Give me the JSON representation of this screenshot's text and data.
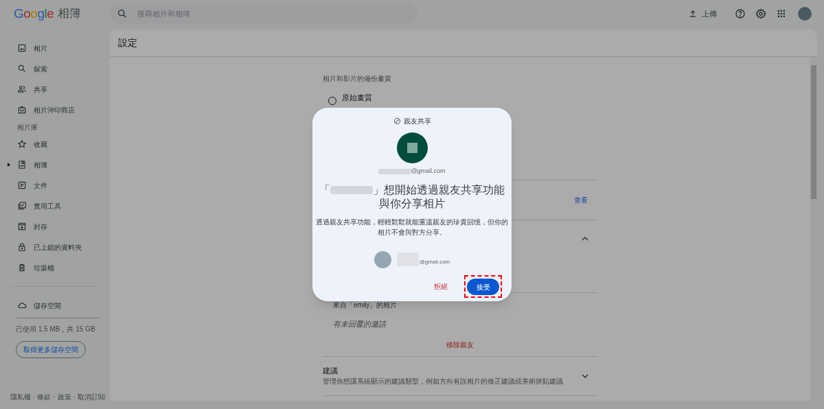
{
  "app": {
    "logo": "Google",
    "product": "相簿"
  },
  "search": {
    "placeholder": "搜尋相片和相簿"
  },
  "toolbar": {
    "upload": "上傳"
  },
  "sidebar": {
    "items": [
      {
        "kind": "item",
        "label": "相片"
      },
      {
        "kind": "item",
        "label": "探索"
      },
      {
        "kind": "item",
        "label": "共享"
      },
      {
        "kind": "item",
        "label": "相片沖印商店"
      },
      {
        "kind": "section",
        "label": "相片庫"
      },
      {
        "kind": "item",
        "label": "收藏"
      },
      {
        "kind": "tree",
        "label": "相簿",
        "expanded": false
      },
      {
        "kind": "item",
        "label": "文件"
      },
      {
        "kind": "item",
        "label": "實用工具"
      },
      {
        "kind": "item",
        "label": "封存"
      },
      {
        "kind": "item",
        "label": "已上鎖的資料夾"
      },
      {
        "kind": "item",
        "label": "垃圾桶"
      }
    ],
    "storage": {
      "label": "儲存空間",
      "usage": "已使用 1.5 MB，共 15 GB",
      "button": "取得更多儲存空間"
    },
    "footer": {
      "links": [
        "隱私權",
        "條款",
        "政策",
        "取消訂閱"
      ],
      "separator": "·"
    }
  },
  "settings": {
    "title": "設定",
    "backup": {
      "heading": "相片和影片的備份畫質",
      "options": [
        {
          "label": "原始畫質",
          "selected": false
        }
      ]
    },
    "view_link": "查看",
    "partner": {
      "expanded": true,
      "from": "來自「emily」的相片",
      "pending": "有未回覆的邀請",
      "remove": "移除親友"
    },
    "suggestions": {
      "title": "建議",
      "description": "管理你想讓系統顯示的建議類型，例如方向有誤相片的修正建議或美術拼貼建議",
      "expanded": false
    }
  },
  "dialog": {
    "header": "親友共享",
    "sender_email": "@gmail.com",
    "title_open": "「",
    "title_rest": "」想開始透過親友共享功能與你分享相片",
    "body": "透過親友共享功能，輕輕鬆鬆就能重溫親友的珍貴回憶，但你的相片不會與對方分享。",
    "recipient_email": "@gmail.com",
    "decline": "拒絕",
    "accept": "接受",
    "accept_highlighted": true
  }
}
